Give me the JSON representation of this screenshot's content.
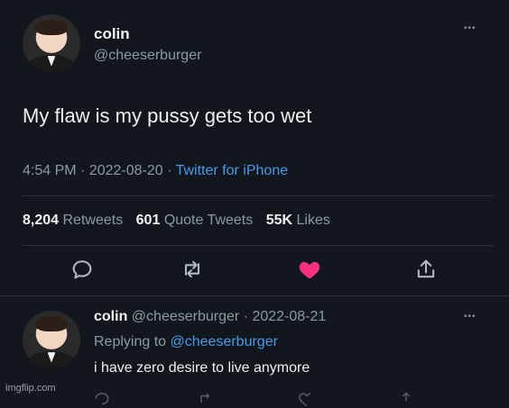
{
  "tweet": {
    "author_name": "colin",
    "author_handle": "@cheeserburger",
    "more_label": "•••",
    "text": "My flaw is my pussy gets too wet",
    "time": "4:54 PM",
    "date": "2022-08-20",
    "source": "Twitter for iPhone",
    "stats": {
      "retweets_count": "8,204",
      "retweets_label": "Retweets",
      "quotes_count": "601",
      "quotes_label": "Quote Tweets",
      "likes_count": "55K",
      "likes_label": "Likes"
    },
    "actions": {
      "reply_icon": "reply-icon",
      "retweet_icon": "retweet-icon",
      "like_icon": "heart-icon",
      "share_icon": "share-icon",
      "liked_color": "#f5307c"
    }
  },
  "reply": {
    "author_name": "colin",
    "author_handle": "@cheeserburger",
    "date": "2022-08-21",
    "more_label": "•••",
    "replying_prefix": "Replying to",
    "replying_to": "@cheeserburger",
    "text": "i have zero desire to live anymore"
  },
  "watermark": "imgflip.com"
}
